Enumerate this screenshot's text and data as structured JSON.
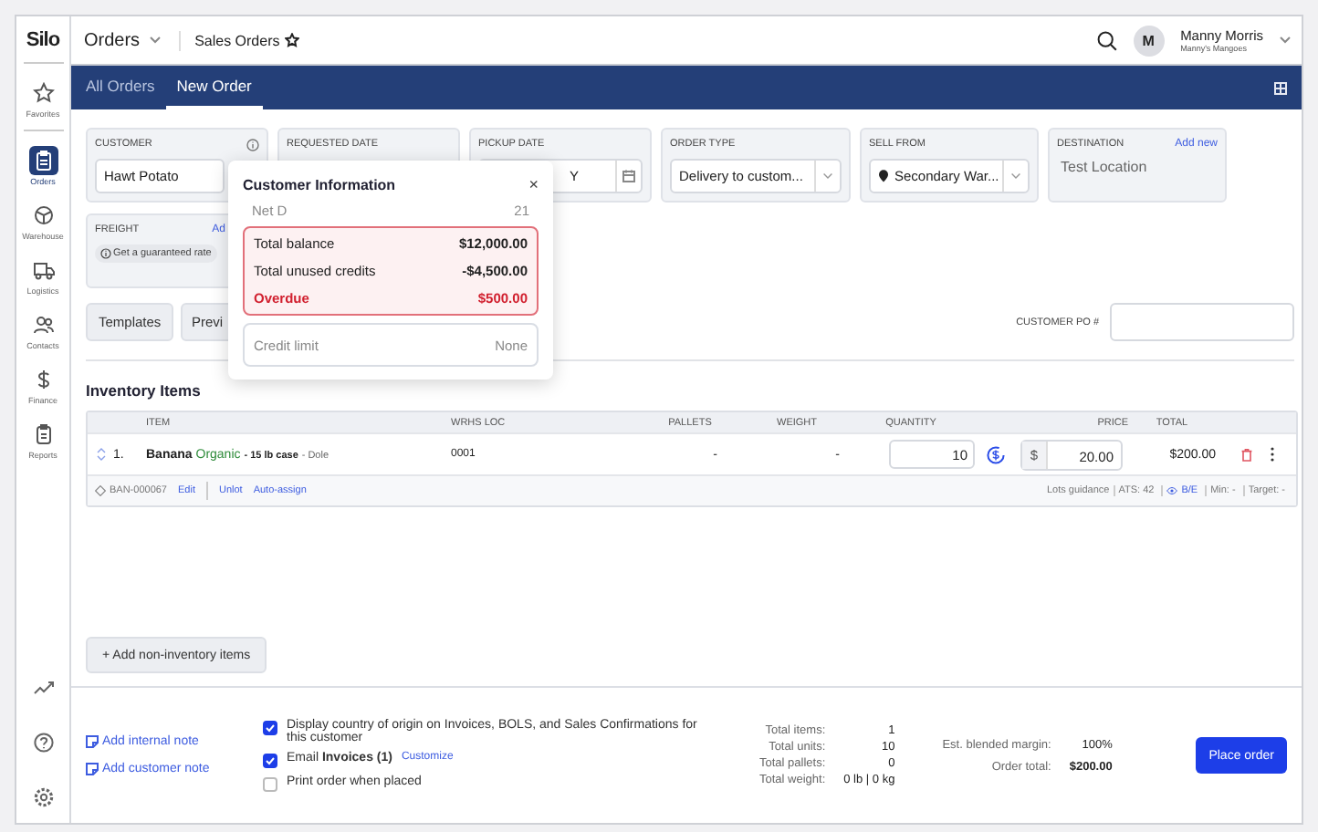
{
  "header": {
    "logo": "Silo",
    "module": "Orders",
    "page": "Sales Orders",
    "user": {
      "initial": "M",
      "name": "Manny Morris",
      "org": "Manny's Mangoes"
    }
  },
  "sidebar": {
    "items": [
      {
        "label": "Favorites",
        "selected": false
      },
      {
        "label": "Orders",
        "selected": true
      },
      {
        "label": "Warehouse",
        "selected": false
      },
      {
        "label": "Logistics",
        "selected": false
      },
      {
        "label": "Contacts",
        "selected": false
      },
      {
        "label": "Finance",
        "selected": false
      },
      {
        "label": "Reports",
        "selected": false
      }
    ]
  },
  "tabs": [
    {
      "label": "All Orders",
      "selected": false
    },
    {
      "label": "New Order",
      "selected": true
    }
  ],
  "fields": [
    {
      "label": "CUSTOMER",
      "kind": "input",
      "value": "Hawt Potato"
    },
    {
      "label": "REQUESTED DATE",
      "kind": "blank"
    },
    {
      "label": "PICKUP DATE",
      "kind": "date",
      "value": "Y"
    },
    {
      "label": "ORDER TYPE",
      "kind": "select",
      "value": "Delivery to custom..."
    },
    {
      "label": "SELL FROM",
      "kind": "location",
      "value": "Secondary War..."
    },
    {
      "label": "DESTINATION",
      "kind": "text",
      "value": "Test Location",
      "link": "Add new"
    }
  ],
  "freight": {
    "label": "FREIGHT",
    "link": "Ad",
    "rate": "Get a guaranteed rate"
  },
  "buttons": [
    "Templates",
    "Previ"
  ],
  "customer_po": {
    "label": "CUSTOMER PO #"
  },
  "popover": {
    "title": "Customer Information",
    "close": "×",
    "terms": {
      "label": "Net D",
      "value": "21"
    },
    "balances": [
      {
        "label": "Total balance",
        "value": "$12,000.00",
        "overdue": false
      },
      {
        "label": "Total unused credits",
        "value": "-$4,500.00",
        "overdue": false
      },
      {
        "label": "Overdue",
        "value": "$500.00",
        "overdue": true
      }
    ],
    "credit_limit": {
      "label": "Credit limit",
      "value": "None"
    }
  },
  "inventory": {
    "title": "Inventory Items",
    "columns": [
      "ITEM",
      "WRHS LOC",
      "PALLETS",
      "WEIGHT",
      "QUANTITY",
      "PRICE",
      "TOTAL"
    ],
    "rows": [
      {
        "number": "1.",
        "name": "Banana",
        "tag": "Organic",
        "detail": "- 15 lb case",
        "brand": "- Dole",
        "wrhs_loc": "0001",
        "pallets": "-",
        "weight": "-",
        "quantity": "10",
        "currency": "$",
        "price": "20.00",
        "total": "$200.00",
        "sku": "BAN-000067",
        "links": [
          "Edit",
          "Unlot",
          "Auto-assign"
        ],
        "lots_guidance": "Lots guidance",
        "ats": "ATS: 42",
        "be": "B/E",
        "min": "Min: -",
        "target": "Target: -"
      }
    ]
  },
  "add_non_inventory": "+ Add non-inventory items",
  "notes": [
    "Add internal note",
    "Add customer note"
  ],
  "options": [
    {
      "label": "Display country of origin on Invoices, BOLS, and Sales Confirmations for this customer",
      "checked": true
    },
    {
      "label": "Email **Invoices (1)**",
      "link": "Customize",
      "checked": true
    },
    {
      "label": "Print order when placed",
      "checked": false
    }
  ],
  "totals": [
    {
      "label": "Total items:",
      "value": "1"
    },
    {
      "label": "Total units:",
      "value": "10"
    },
    {
      "label": "Total pallets:",
      "value": "0"
    },
    {
      "label": "Total weight:",
      "value": "0 lb | 0 kg"
    }
  ],
  "summary": [
    {
      "label": "Est. blended margin:",
      "value": "100%"
    },
    {
      "label": "Order total:",
      "value": "$200.00"
    }
  ],
  "place_order": "Place order"
}
